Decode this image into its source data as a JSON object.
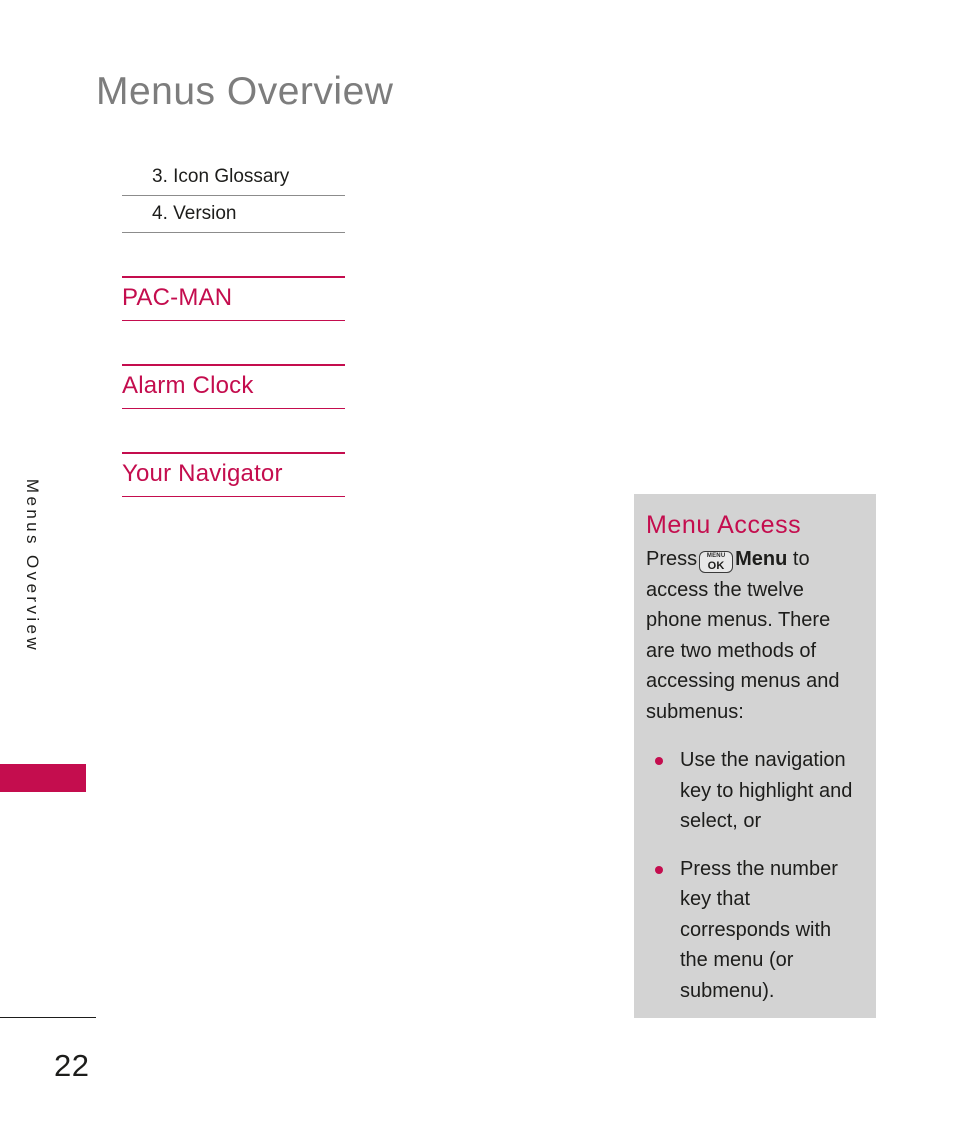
{
  "page": {
    "title": "Menus Overview",
    "running_head": "Menus Overview",
    "number": "22"
  },
  "continued_list": [
    {
      "label": "3. Icon Glossary"
    },
    {
      "label": "4. Version"
    }
  ],
  "sections": [
    {
      "label": "PAC-MAN"
    },
    {
      "label": "Alarm Clock"
    },
    {
      "label": "Your Navigator"
    }
  ],
  "info_box": {
    "title": "Menu Access",
    "paragraph_before_key": "Press",
    "key": {
      "top": "MENU",
      "bottom": "OK"
    },
    "paragraph_bold": "Menu",
    "paragraph_after_key": "to access the twelve phone menus. There are two methods of accessing menus and submenus:",
    "bullets": [
      {
        "text": "Use the navigation key to highlight and select, or"
      },
      {
        "text": "Press the number key that corresponds with the menu (or submenu)."
      }
    ]
  },
  "colors": {
    "accent": "#c40d4e",
    "title_gray": "#7d7d7d",
    "box_background": "#d3d3d3",
    "body_text": "#1d1d1b",
    "rule_gray": "#8c8c8c"
  }
}
